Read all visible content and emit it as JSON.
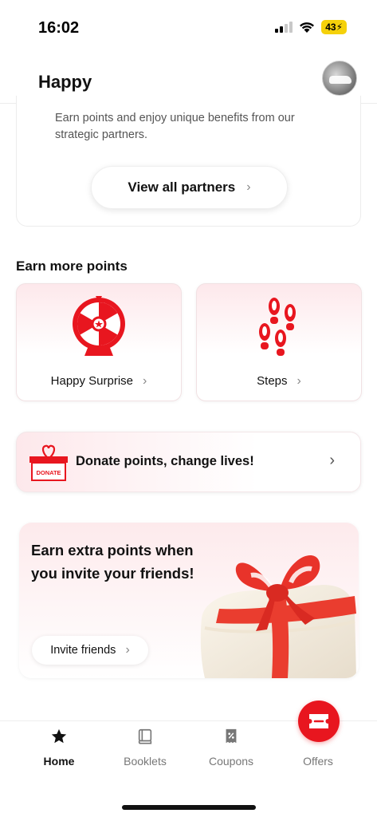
{
  "status_bar": {
    "time": "16:02",
    "battery": "43"
  },
  "header": {
    "title": "Happy"
  },
  "partners": {
    "description": "Earn points and enjoy unique benefits from our strategic partners.",
    "button_label": "View all partners"
  },
  "earn_more": {
    "title": "Earn more points",
    "cards": [
      {
        "label": "Happy Surprise",
        "icon": "prize-wheel-icon"
      },
      {
        "label": "Steps",
        "icon": "footsteps-icon"
      }
    ]
  },
  "donate": {
    "label": "Donate points, change lives!",
    "box_text": "DONATE"
  },
  "invite": {
    "title": "Earn extra points when you invite your friends!",
    "button_label": "Invite friends"
  },
  "tabs": [
    {
      "label": "Home",
      "icon": "star-icon",
      "active": true
    },
    {
      "label": "Booklets",
      "icon": "booklet-icon",
      "active": false
    },
    {
      "label": "Coupons",
      "icon": "coupon-icon",
      "active": false
    },
    {
      "label": "Offers",
      "icon": "ticket-icon",
      "active": false
    }
  ],
  "colors": {
    "accent": "#e8161f",
    "card_tint": "#fde8eb",
    "battery": "#f5d10a"
  }
}
